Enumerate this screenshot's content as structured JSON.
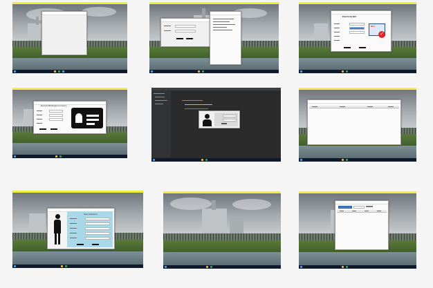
{
  "gallery": {
    "thumbnails": [
      {
        "name": "blank-form-window"
      },
      {
        "name": "login-and-console-window"
      },
      {
        "name": "electricity-bill-window"
      },
      {
        "name": "id-card-registration-window"
      },
      {
        "name": "ide-with-login-dialog"
      },
      {
        "name": "table-view-window"
      },
      {
        "name": "add-customer-window"
      },
      {
        "name": "desktop-wallpaper"
      },
      {
        "name": "search-table-window"
      }
    ]
  },
  "windows": {
    "bill": {
      "title": "Electricity Bill",
      "badge": "BILL"
    },
    "idcard": {
      "title": "Electricity Bill Management System"
    },
    "customer": {
      "title": "New Customer"
    }
  },
  "colors": {
    "accent_yellow": "#f4ee3a",
    "taskbar": "#0f1a2a",
    "ide_bg": "#2b2b2b",
    "customer_panel": "#a9d8e8",
    "check_red": "#e0262b"
  }
}
